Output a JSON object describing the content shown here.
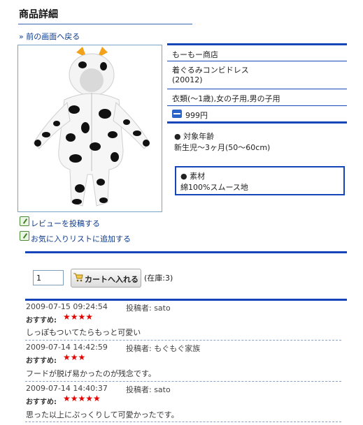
{
  "header": {
    "title": "商品詳細",
    "back_link": "» 前の画面へ戻る"
  },
  "product": {
    "shop": "もーもー商店",
    "name": "着ぐるみコンビドレス",
    "code": "(20012)",
    "category": "衣類(～1歳),女の子用,男の子用",
    "price": "999円",
    "age_label": "● 対象年齢",
    "age_value": "新生児～3ヶ月(50～60cm)",
    "material_label": "● 素材",
    "material_value": "綿100%スムース地"
  },
  "actions": {
    "review": "レビューを投稿する",
    "favorite": "お気に入りリストに追加する"
  },
  "cart": {
    "quantity": "1",
    "button_label": "カートへ入れる",
    "stock": "(在庫:3)"
  },
  "reviews": [
    {
      "date": "2009-07-15 09:24:54",
      "author": "投稿者: sato",
      "recommend_label": "おすすめ:",
      "stars": "★★★★",
      "text": "しっぽもついてたらもっと可愛い"
    },
    {
      "date": "2009-07-14 14:42:59",
      "author": "投稿者: もぐもぐ家族",
      "recommend_label": "おすすめ:",
      "stars": "★★★",
      "text": "フードが脱げ易かったのが残念です。"
    },
    {
      "date": "2009-07-14 14:40:37",
      "author": "投稿者: sato",
      "recommend_label": "おすすめ:",
      "stars": "★★★★★",
      "text": "思った以上にぷっくりして可愛かったです。"
    }
  ],
  "colors": {
    "accent_blue": "#1545b8",
    "link": "#0b3a8f",
    "stars": "#e60000"
  }
}
